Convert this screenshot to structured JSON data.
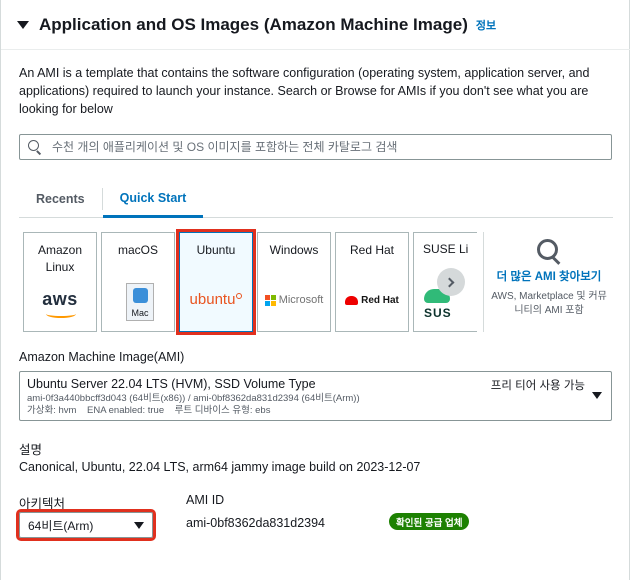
{
  "section": {
    "title": "Application and OS Images (Amazon Machine Image)",
    "info_link": "정보",
    "description": "An AMI is a template that contains the software configuration (operating system, application server, and applications) required to launch your instance. Search or Browse for AMIs if you don't see what you are looking for below"
  },
  "search": {
    "placeholder": "수천 개의 애플리케이션 및 OS 이미지를 포함하는 전체 카탈로그 검색"
  },
  "tabs": [
    {
      "label": "Recents",
      "active": false
    },
    {
      "label": "Quick Start",
      "active": true
    }
  ],
  "os_options": [
    {
      "name": "Amazon Linux",
      "logo_text": "aws",
      "icon": "aws-logo-icon"
    },
    {
      "name": "macOS",
      "logo_text": "Mac",
      "icon": "mac-finder-icon"
    },
    {
      "name": "Ubuntu",
      "logo_text": "ubuntu",
      "icon": "ubuntu-logo-icon",
      "selected": true
    },
    {
      "name": "Windows",
      "logo_text": "Microsoft",
      "icon": "microsoft-logo-icon"
    },
    {
      "name": "Red Hat",
      "logo_text": "Red Hat",
      "icon": "redhat-logo-icon"
    },
    {
      "name": "SUSE Li",
      "logo_text": "SUS",
      "icon": "suse-logo-icon"
    }
  ],
  "browse_more": {
    "link": "더 많은 AMI 찾아보기",
    "subtext": "AWS, Marketplace 및 커뮤니티의 AMI 포함",
    "icon": "search-icon"
  },
  "ami": {
    "label": "Amazon Machine Image(AMI)",
    "name": "Ubuntu Server 22.04 LTS (HVM), SSD Volume Type",
    "ids": "ami-0f3a440bbcff3d043 (64비트(x86)) / ami-0bf8362da831d2394 (64비트(Arm))",
    "details": "가상화: hvm    ENA enabled: true    루트 디바이스 유형: ebs",
    "free_tier": "프리 티어 사용 가능"
  },
  "description_field": {
    "label": "설명",
    "value": "Canonical, Ubuntu, 22.04 LTS, arm64 jammy image build on 2023-12-07"
  },
  "architecture": {
    "label": "아키텍처",
    "value": "64비트(Arm)"
  },
  "ami_id": {
    "label": "AMI ID",
    "value": "ami-0bf8362da831d2394",
    "badge": "확인된 공급 업체"
  },
  "colors": {
    "link": "#0073bb",
    "badge_green": "#1d8102",
    "highlight_red": "#e0301e"
  }
}
